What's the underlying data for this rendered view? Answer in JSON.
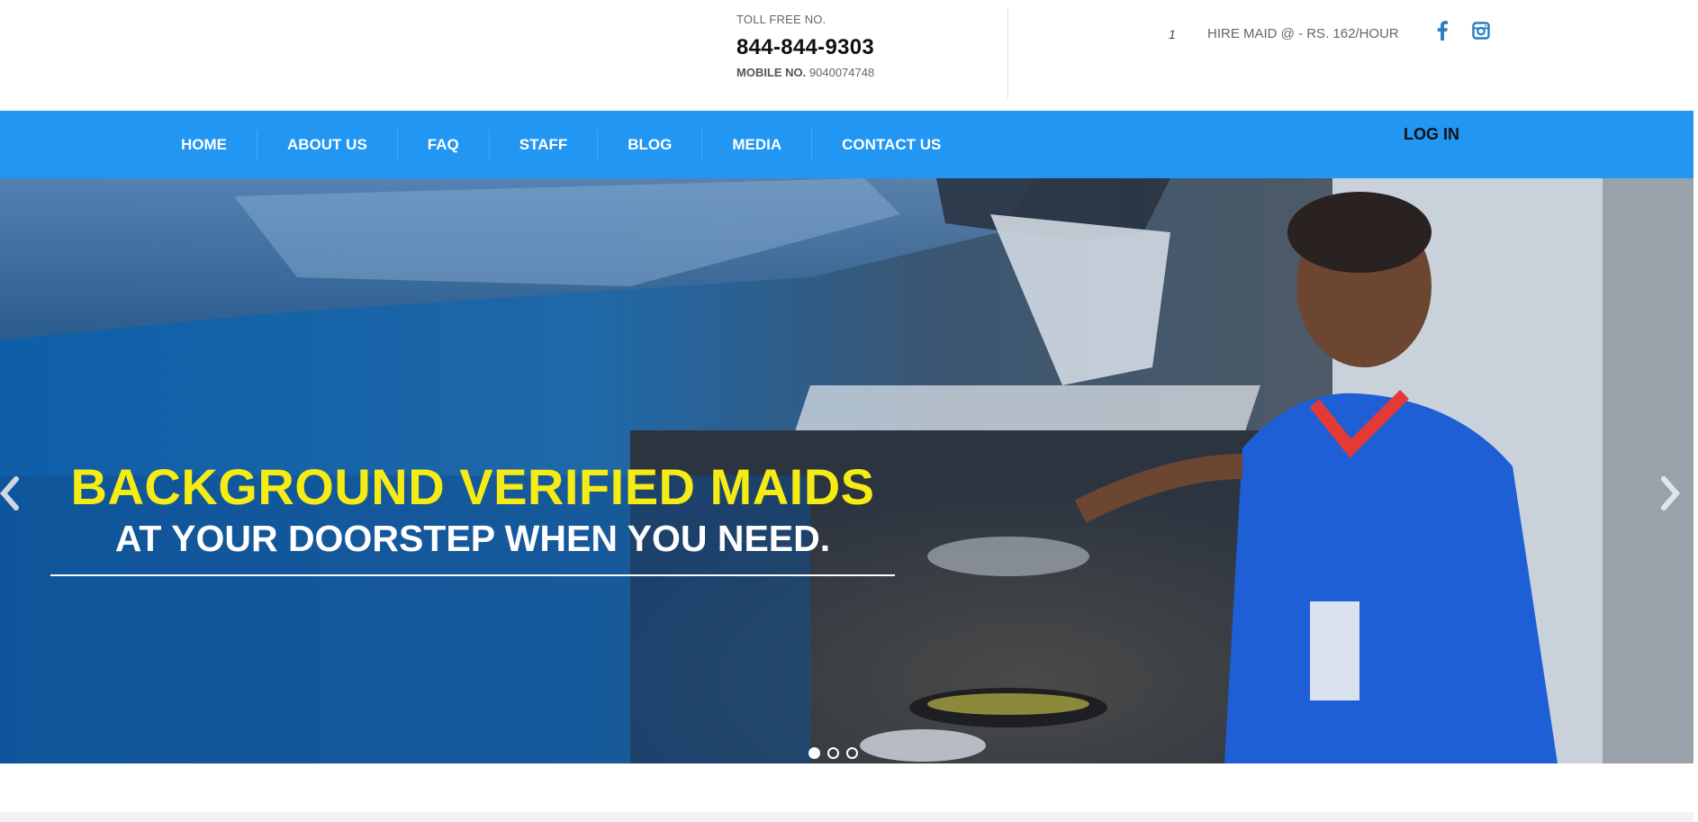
{
  "header": {
    "toll_free_label": "TOLL FREE NO.",
    "toll_free_number": "844-844-9303",
    "mobile_label": "MOBILE NO.",
    "mobile_number": "9040074748",
    "hire_count": "1",
    "hire_text": "HIRE MAID @ - RS. 162/HOUR",
    "social": [
      {
        "icon": "facebook-icon"
      },
      {
        "icon": "instagram-icon"
      }
    ]
  },
  "nav": {
    "items": [
      {
        "label": "HOME"
      },
      {
        "label": "ABOUT US"
      },
      {
        "label": "FAQ"
      },
      {
        "label": "STAFF"
      },
      {
        "label": "BLOG"
      },
      {
        "label": "MEDIA"
      },
      {
        "label": "CONTACT US"
      }
    ],
    "login_label": "LOG IN"
  },
  "hero": {
    "headline": "BACKGROUND VERIFIED MAIDS",
    "subline": "AT YOUR DOORSTEP WHEN YOU NEED.",
    "slides_total": 3,
    "active_slide": 1
  },
  "colors": {
    "nav_bg": "#2196f3",
    "headline": "#f5ec13",
    "brand_icon": "#2a7dc0"
  }
}
